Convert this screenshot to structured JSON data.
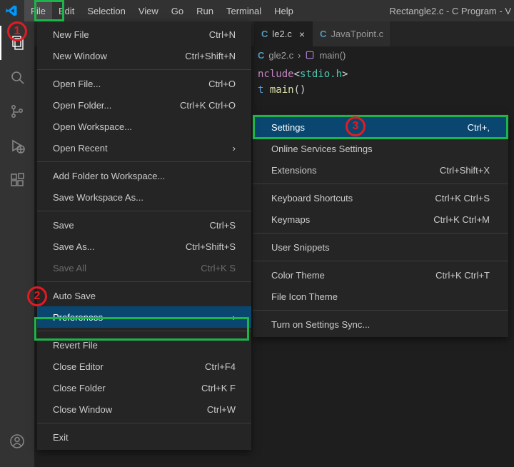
{
  "menubar": {
    "items": [
      "File",
      "Edit",
      "Selection",
      "View",
      "Go",
      "Run",
      "Terminal",
      "Help"
    ],
    "title_right": "Rectangle2.c - C Program - V"
  },
  "dropdown": {
    "groups": [
      [
        {
          "label": "New File",
          "shortcut": "Ctrl+N"
        },
        {
          "label": "New Window",
          "shortcut": "Ctrl+Shift+N"
        }
      ],
      [
        {
          "label": "Open File...",
          "shortcut": "Ctrl+O"
        },
        {
          "label": "Open Folder...",
          "shortcut": "Ctrl+K Ctrl+O"
        },
        {
          "label": "Open Workspace...",
          "shortcut": ""
        },
        {
          "label": "Open Recent",
          "shortcut": "",
          "submenu": true
        }
      ],
      [
        {
          "label": "Add Folder to Workspace...",
          "shortcut": ""
        },
        {
          "label": "Save Workspace As...",
          "shortcut": ""
        }
      ],
      [
        {
          "label": "Save",
          "shortcut": "Ctrl+S"
        },
        {
          "label": "Save As...",
          "shortcut": "Ctrl+Shift+S"
        },
        {
          "label": "Save All",
          "shortcut": "Ctrl+K S",
          "disabled": true
        }
      ],
      [
        {
          "label": "Auto Save",
          "shortcut": ""
        },
        {
          "label": "Preferences",
          "shortcut": "",
          "submenu": true,
          "highlight": true
        }
      ],
      [
        {
          "label": "Revert File",
          "shortcut": ""
        },
        {
          "label": "Close Editor",
          "shortcut": "Ctrl+F4"
        },
        {
          "label": "Close Folder",
          "shortcut": "Ctrl+K F"
        },
        {
          "label": "Close Window",
          "shortcut": "Ctrl+W"
        }
      ],
      [
        {
          "label": "Exit",
          "shortcut": ""
        }
      ]
    ]
  },
  "submenu": {
    "groups": [
      [
        {
          "label": "Settings",
          "shortcut": "Ctrl+,",
          "highlight": true
        },
        {
          "label": "Online Services Settings",
          "shortcut": ""
        },
        {
          "label": "Extensions",
          "shortcut": "Ctrl+Shift+X"
        }
      ],
      [
        {
          "label": "Keyboard Shortcuts",
          "shortcut": "Ctrl+K Ctrl+S"
        },
        {
          "label": "Keymaps",
          "shortcut": "Ctrl+K Ctrl+M"
        }
      ],
      [
        {
          "label": "User Snippets",
          "shortcut": ""
        }
      ],
      [
        {
          "label": "Color Theme",
          "shortcut": "Ctrl+K Ctrl+T"
        },
        {
          "label": "File Icon Theme",
          "shortcut": ""
        }
      ],
      [
        {
          "label": "Turn on Settings Sync...",
          "shortcut": ""
        }
      ]
    ]
  },
  "tabs": {
    "active": {
      "name": "le2.c"
    },
    "inactive": {
      "name": "JavaTpoint.c"
    }
  },
  "breadcrumbs": {
    "file": "gle2.c",
    "symbol": "main()"
  },
  "code": {
    "line1": {
      "prefix": "nclude",
      "bracket_open": "<",
      "header": "stdio.h",
      "bracket_close": ">"
    },
    "line2": {
      "type": "t",
      "space": " ",
      "fn": "main",
      "paren": "()"
    }
  },
  "annotations": {
    "n1": "1",
    "n2": "2",
    "n3": "3"
  }
}
